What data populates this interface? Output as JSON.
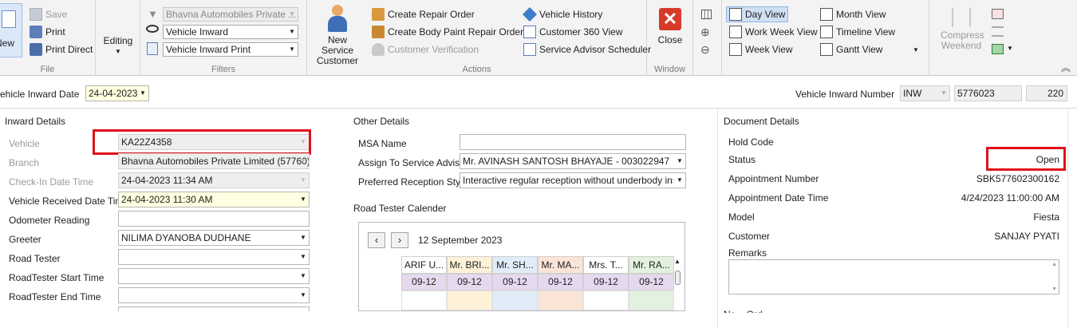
{
  "ribbon": {
    "file": {
      "caption": "File",
      "new_label": "New",
      "save_label": "Save",
      "print_label": "Print",
      "print_direct_label": "Print Direct"
    },
    "editing": {
      "label": "Editing"
    },
    "filters": {
      "caption": "Filters",
      "branch_value": "Bhavna Automobiles Private ...",
      "form_value": "Vehicle Inward",
      "print_value": "Vehicle Inward Print"
    },
    "actions": {
      "caption": "Actions",
      "new_service_customer": "New Service Customer",
      "create_repair_order": "Create Repair Order",
      "create_body_paint": "Create Body  Paint Repair Order",
      "customer_verification": "Customer Verification",
      "vehicle_history": "Vehicle History",
      "customer_360": "Customer 360 View",
      "service_advisor_scheduler": "Service Advisor Scheduler"
    },
    "window": {
      "caption": "Window",
      "close_label": "Close"
    },
    "views": {
      "day_view": "Day View",
      "work_week_view": "Work Week View",
      "week_view": "Week View",
      "month_view": "Month View",
      "timeline_view": "Timeline View",
      "gantt_view": "Gantt View",
      "compress_weekend": "Compress Weekend"
    }
  },
  "header": {
    "inward_date_label": "ehicle Inward Date",
    "inward_date_value": "24-04-2023",
    "inward_number_label": "Vehicle Inward Number",
    "inward_prefix": "INW",
    "inward_number": "5776023",
    "inward_suffix": "220"
  },
  "inward_details": {
    "title": "Inward Details",
    "vehicle_label": "Vehicle",
    "vehicle_value": "KA22Z4358",
    "branch_label": "Branch",
    "branch_value": "Bhavna Automobiles Private Limited (57760)",
    "checkin_label": "Check-In Date Time",
    "checkin_value": "24-04-2023 11:34 AM",
    "received_label": "Vehicle Received Date  Time",
    "received_value": "24-04-2023 11:30 AM",
    "odometer_label": "Odometer Reading",
    "odometer_value": "",
    "greeter_label": "Greeter",
    "greeter_value": "NILIMA  DYANOBA  DUDHANE",
    "road_tester_label": "Road Tester",
    "road_tester_value": "",
    "rt_start_label": "RoadTester Start Time",
    "rt_start_value": "",
    "rt_end_label": "RoadTester End Time",
    "rt_end_value": ""
  },
  "other_details": {
    "title": "Other Details",
    "msa_label": "MSA Name",
    "msa_value": "",
    "advisor_label": "Assign To Service Advisor",
    "advisor_value": "Mr. AVINASH  SANTOSH  BHAYAJE - 003022947",
    "reception_label": "Preferred Reception Style",
    "reception_value": "Interactive regular reception without underbody ins..."
  },
  "calendar": {
    "title": "Road Tester Calender",
    "date": "12 September 2023",
    "columns": [
      {
        "name": "ARIF U...",
        "date": "09-12",
        "color": "#ffffff"
      },
      {
        "name": "Mr. BRI...",
        "date": "09-12",
        "color": "#fdf2d8"
      },
      {
        "name": "Mr. SH...",
        "date": "09-12",
        "color": "#e1ecf9"
      },
      {
        "name": "Mr. MA...",
        "date": "09-12",
        "color": "#fbe5d6"
      },
      {
        "name": "Mrs. T...",
        "date": "09-12",
        "color": "#ffffff"
      },
      {
        "name": "Mr. RA...",
        "date": "09-12",
        "color": "#e3f1df"
      }
    ]
  },
  "document_details": {
    "title": "Document Details",
    "hold_code_label": "Hold Code",
    "hold_code_value": "",
    "status_label": "Status",
    "status_value": "Open",
    "appt_number_label": "Appointment Number",
    "appt_number_value": "SBK577602300162",
    "appt_date_label": "Appointment Date Time",
    "appt_date_value": "4/24/2023 11:00:00 AM",
    "model_label": "Model",
    "model_value": "Fiesta",
    "customer_label": "Customer",
    "customer_value": "SANJAY PYATI",
    "remarks_label": "Remarks",
    "remarks_value": "",
    "cut_label": "Ne... Ord..."
  },
  "colors": {
    "highlight_red": "#e0101a",
    "ribbon_bg": "#f3f3f3",
    "date_yellow": "#ffffe1",
    "selected_view": "#cfe0f5"
  }
}
